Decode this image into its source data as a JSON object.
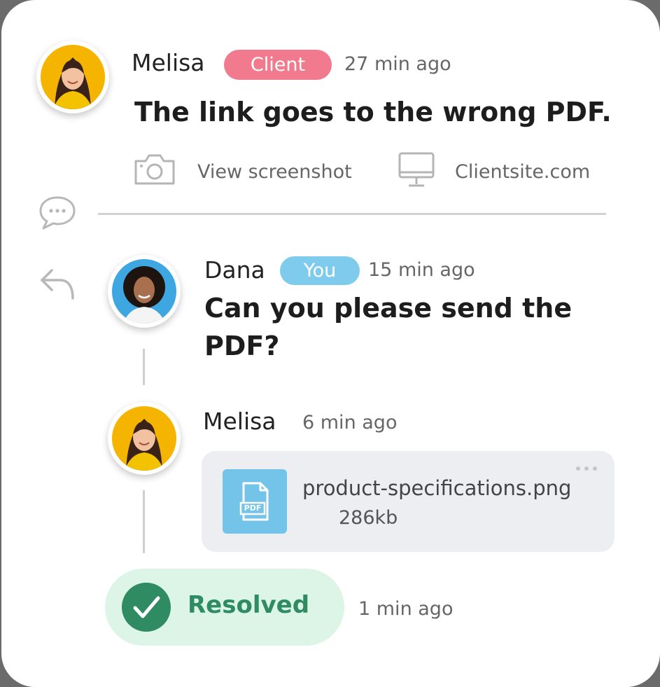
{
  "comments": [
    {
      "author": "Melisa",
      "badge": "Client",
      "badge_color": "#f27a8e",
      "time": "27 min ago",
      "text": "The link goes to the wrong PDF.",
      "screenshot_link": "View screenshot",
      "site": "Clientsite.com"
    },
    {
      "author": "Dana",
      "badge": "You",
      "badge_color": "#7fcbee",
      "time": "15 min ago",
      "text_line1": "Can you please send the",
      "text_line2": "PDF?"
    },
    {
      "author": "Melisa",
      "time": "6 min ago",
      "attachment": {
        "filename": "product-specifications.png",
        "size": "286kb",
        "icon_label": "PDF",
        "icon_color": "#74c3e8"
      }
    }
  ],
  "resolved": {
    "label": "Resolved",
    "time": "1 min ago",
    "color": "#2e8b62",
    "bg_color": "#dcf5e7"
  },
  "icons": [
    "camera-icon",
    "monitor-icon",
    "chat-bubble-icon",
    "reply-icon",
    "pdf-file-icon",
    "more-options-icon",
    "checkmark-icon"
  ]
}
